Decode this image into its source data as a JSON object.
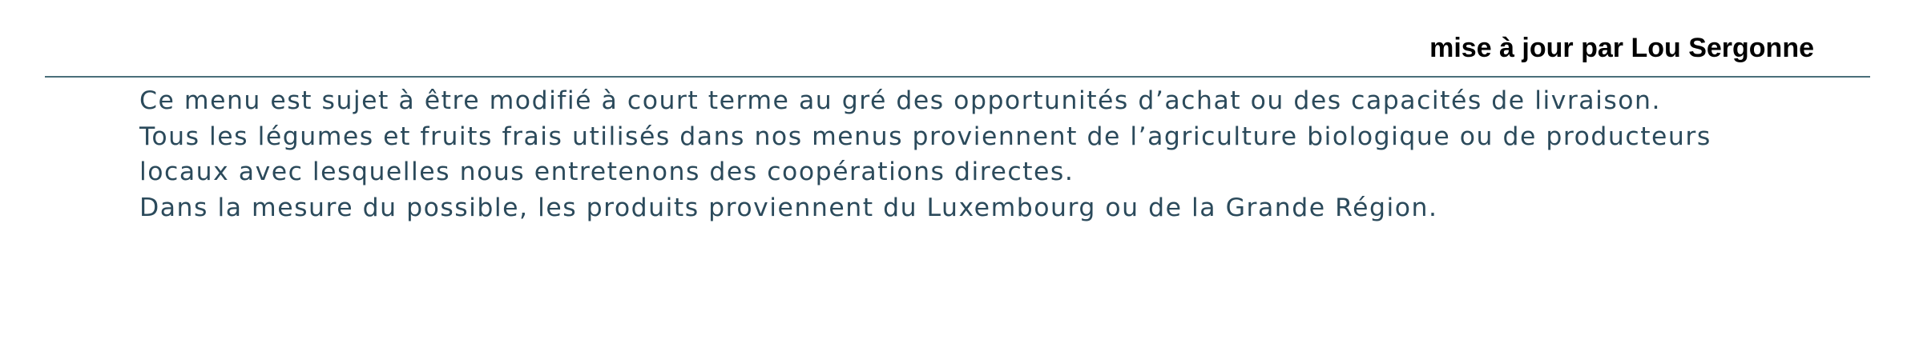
{
  "header": {
    "credit": "mise à jour par Lou Sergonne"
  },
  "notes": {
    "lines": [
      "Ce menu est sujet à être modifié à court terme au gré des opportunités d’achat ou des capacités de livraison.",
      "Tous les légumes et fruits frais utilisés dans nos menus proviennent de l’agriculture biologique ou de producteurs",
      "locaux avec lesquelles nous entretenons des coopérations directes.",
      "Dans la mesure du possible, les produits proviennent du Luxembourg ou de la Grande Région."
    ]
  },
  "colors": {
    "text": "#2b4a5b",
    "divider": "#4a6f7a",
    "credit": "#000000"
  }
}
